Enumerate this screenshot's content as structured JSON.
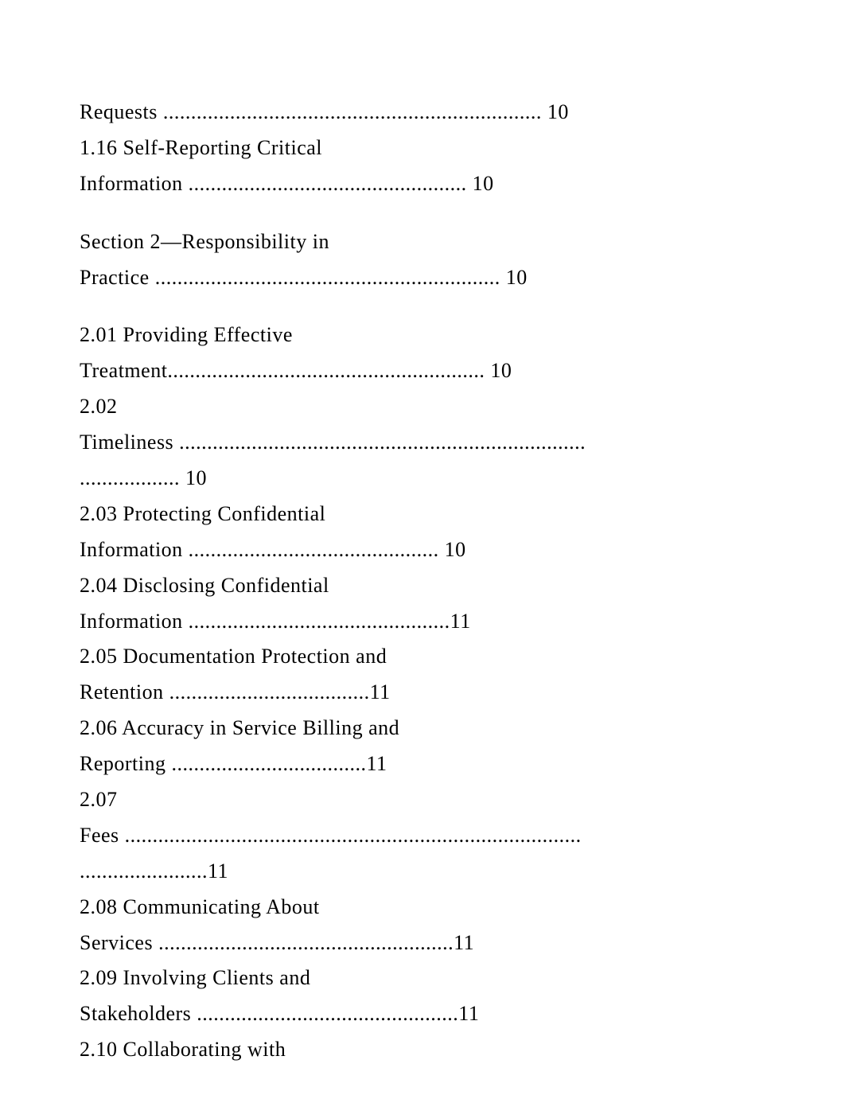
{
  "lines": [
    "Requests .................................................................... 10",
    "1.16 Self-Reporting Critical",
    "Information .................................................. 10",
    "",
    "Section 2—Responsibility in",
    "Practice .............................................................. 10",
    "",
    "2.01 Providing Effective",
    "Treatment......................................................... 10",
    "2.02",
    "Timeliness .........................................................................",
    ".................. 10",
    "2.03 Protecting Confidential",
    "Information ............................................. 10",
    "2.04 Disclosing Confidential",
    "Information ...............................................11",
    "2.05 Documentation Protection and",
    "Retention ....................................11",
    "2.06 Accuracy in Service Billing and",
    "Reporting ...................................11",
    "2.07",
    "Fees ..................................................................................",
    ".......................11",
    "2.08 Communicating About",
    "Services .....................................................11",
    "2.09 Involving Clients and",
    "Stakeholders ...............................................11",
    "2.10 Collaborating with"
  ]
}
